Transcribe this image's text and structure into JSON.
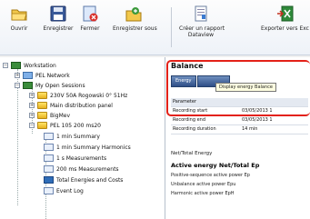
{
  "toolbar": {
    "buttons": [
      {
        "label": "Ouvrir",
        "icon": "open-folder-icon"
      },
      {
        "label": "Enregistrer",
        "icon": "save-disk-icon"
      },
      {
        "label": "Fermer",
        "icon": "close-document-icon"
      },
      {
        "label": "Enregistrer sous",
        "icon": "save-as-folder-icon"
      },
      {
        "label": "Créer un rapport",
        "label2": "Dataview",
        "icon": "report-icon"
      },
      {
        "label": "Exporter vers Exc",
        "icon": "export-excel-icon"
      }
    ]
  },
  "tree": {
    "workstation": "Workstation",
    "pel_network": "PEL Network",
    "my_open_sessions": "My Open Sessions",
    "session_a": "230V 50A Rogowski 0° 51Hz",
    "session_b": "Main distribution panel",
    "session_c": "BigMev",
    "session_d": "PEL 105 200 ms20",
    "item_1": "1 min Summary",
    "item_2": "1 min Summary Harmonics",
    "item_3": "1 s Measurements",
    "item_4": "200 ms Measurements",
    "item_5": "Total Energies and Costs",
    "item_6": "Event Log"
  },
  "panel": {
    "title": "Balance",
    "tab_energy": "Energy",
    "tooltip": "Display energy Balance",
    "col_parameter": "Parameter",
    "rows": [
      {
        "k": "Recording start",
        "v": "03/05/2013 1"
      },
      {
        "k": "Recording end",
        "v": "03/05/2013 1"
      },
      {
        "k": "Recording duration",
        "v": "14 min"
      }
    ],
    "net_total_energy": "Net/Total Energy",
    "active_energy_heading": "Active energy Net/Total Ep",
    "line_1": "Positive-sequence active power Ep",
    "line_2": "Unbalance active power Epu",
    "line_3": "Harmonic active power EpH"
  }
}
